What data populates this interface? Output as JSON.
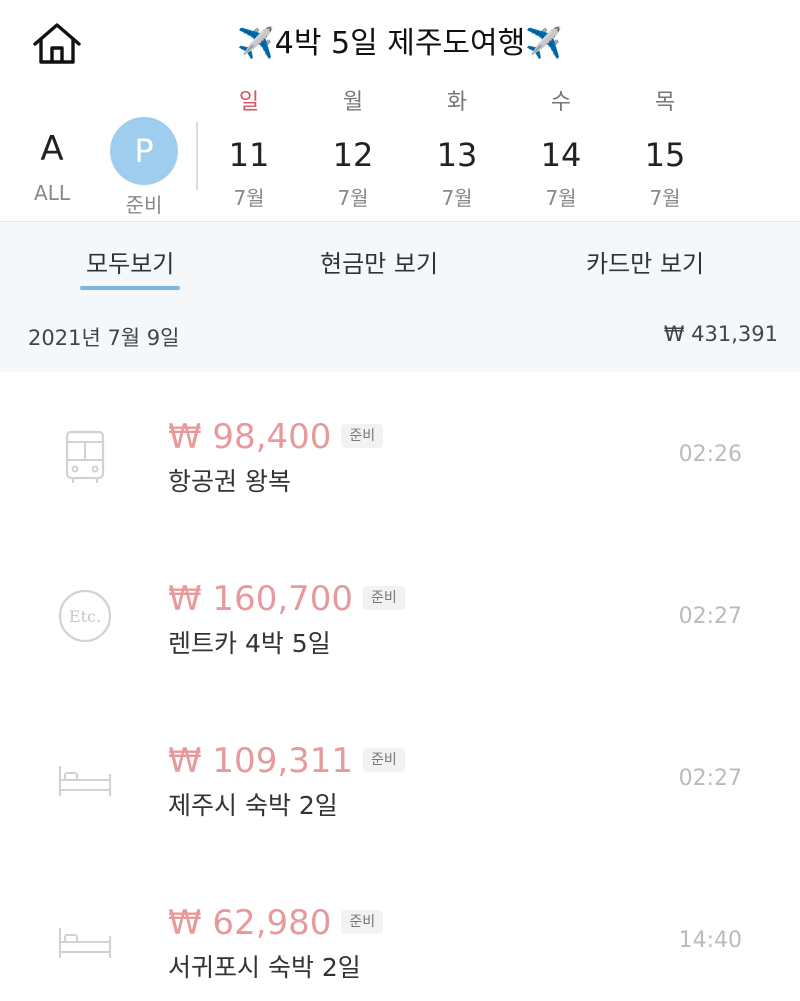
{
  "header": {
    "title": "✈️4박 5일 제주도여행✈️",
    "home_icon": "home-icon"
  },
  "day_selector": {
    "all": {
      "letter": "A",
      "label": "ALL"
    },
    "prep": {
      "letter": "P",
      "label": "준비"
    },
    "days": [
      {
        "weekday": "일",
        "day": "11",
        "month": "7월",
        "weekday_color": "#d9545e"
      },
      {
        "weekday": "월",
        "day": "12",
        "month": "7월"
      },
      {
        "weekday": "화",
        "day": "13",
        "month": "7월"
      },
      {
        "weekday": "수",
        "day": "14",
        "month": "7월"
      },
      {
        "weekday": "목",
        "day": "15",
        "month": "7월"
      }
    ]
  },
  "tabs": [
    {
      "label": "모두보기",
      "active": true
    },
    {
      "label": "현금만 보기",
      "active": false
    },
    {
      "label": "카드만 보기",
      "active": false
    }
  ],
  "summary": {
    "date": "2021년 7월 9일",
    "total": "₩ 431,391"
  },
  "expenses": [
    {
      "amount": "₩ 98,400",
      "badge": "준비",
      "description": "항공권 왕복",
      "time": "02:26",
      "icon": "bus-icon"
    },
    {
      "amount": "₩ 160,700",
      "badge": "준비",
      "description": "렌트카 4박 5일",
      "time": "02:27",
      "icon": "etc-icon"
    },
    {
      "amount": "₩ 109,311",
      "badge": "준비",
      "description": "제주시 숙박 2일",
      "time": "02:27",
      "icon": "bed-icon"
    },
    {
      "amount": "₩ 62,980",
      "badge": "준비",
      "description": "서귀포시 숙박 2일",
      "time": "14:40",
      "icon": "bed-icon"
    }
  ],
  "colors": {
    "amount": "#e79a9c",
    "accent": "#7fb4de",
    "prep_circle": "#9fcdee",
    "sunday": "#d9545e"
  }
}
